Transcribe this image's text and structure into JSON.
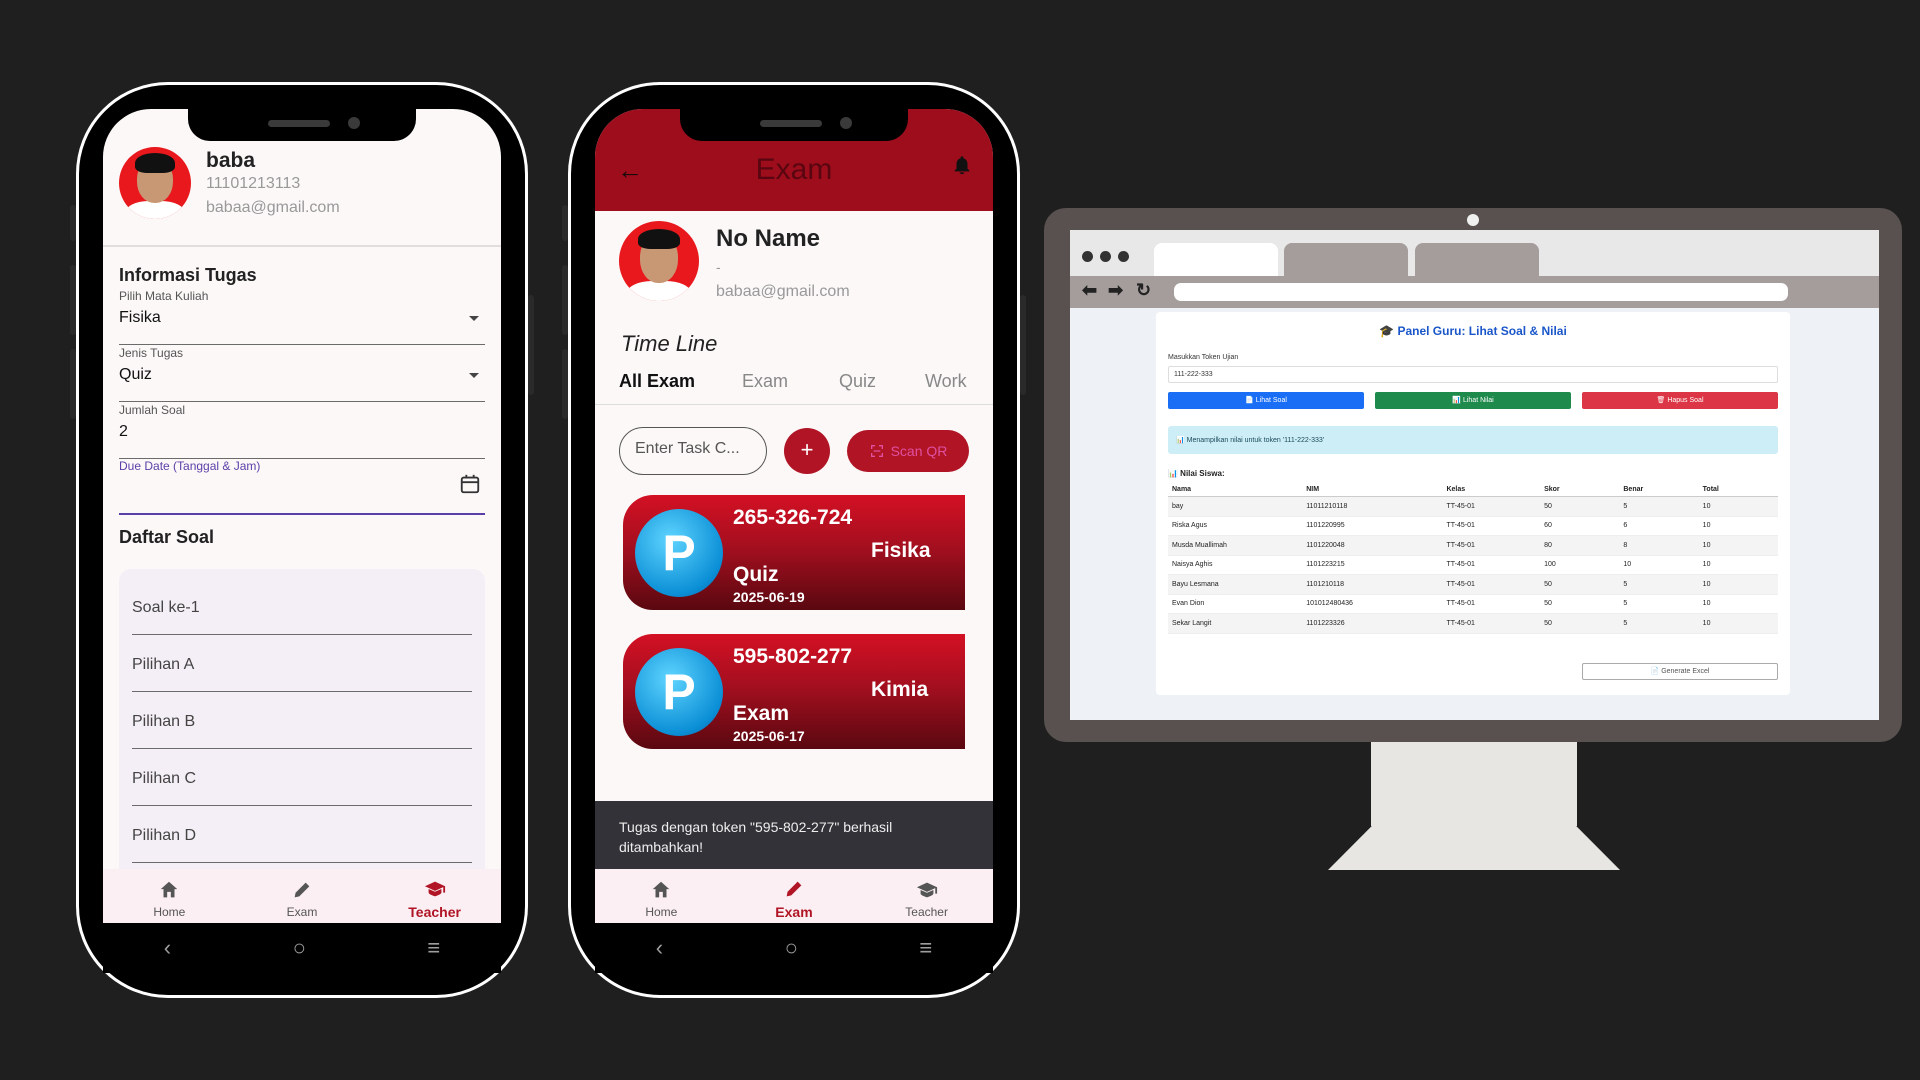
{
  "phone1": {
    "profile": {
      "name": "baba",
      "nim": "11101213113",
      "email": "babaa@gmail.com"
    },
    "form": {
      "section_title": "Informasi Tugas",
      "course": {
        "label": "Pilih Mata Kuliah",
        "value": "Fisika"
      },
      "task_type": {
        "label": "Jenis Tugas",
        "value": "Quiz"
      },
      "question_count": {
        "label": "Jumlah Soal",
        "value": "2"
      },
      "due_date": {
        "label": "Due Date (Tanggal & Jam)",
        "value": ""
      }
    },
    "questions": {
      "section_title": "Daftar Soal",
      "fields": [
        "Soal ke-1",
        "Pilihan A",
        "Pilihan B",
        "Pilihan C",
        "Pilihan D"
      ]
    },
    "bottom_nav": [
      {
        "label": "Home",
        "icon": "home-icon"
      },
      {
        "label": "Exam",
        "icon": "pencil-icon"
      },
      {
        "label": "Teacher",
        "icon": "school-icon"
      }
    ],
    "active_nav": "Teacher"
  },
  "phone2": {
    "appbar_title": "Exam",
    "profile": {
      "name": "No Name",
      "nim": "-",
      "email": "babaa@gmail.com"
    },
    "timeline_title": "Time Line",
    "tabs": [
      "All Exam",
      "Exam",
      "Quiz",
      "Work"
    ],
    "active_tab": "All Exam",
    "task_input_placeholder": "Enter Task C...",
    "plus_label": "+",
    "scan_label": "Scan QR",
    "exams": [
      {
        "badge": "P",
        "token": "265-326-724",
        "type": "Quiz",
        "date": "2025-06-19",
        "subject": "Fisika"
      },
      {
        "badge": "P",
        "token": "595-802-277",
        "type": "Exam",
        "date": "2025-06-17",
        "subject": "Kimia"
      }
    ],
    "snackbar": "Tugas dengan token \"595-802-277\" berhasil ditambahkan!",
    "bottom_nav": [
      {
        "label": "Home",
        "icon": "home-icon"
      },
      {
        "label": "Exam",
        "icon": "pencil-icon"
      },
      {
        "label": "Teacher",
        "icon": "school-icon"
      }
    ],
    "active_nav": "Exam"
  },
  "monitor": {
    "panel_title": "🎓 Panel Guru: Lihat Soal & Nilai",
    "token_label": "Masukkan Token Ujian",
    "token_value": "111-222-333",
    "buttons": {
      "view_questions": "📄 Lihat Soal",
      "view_grades": "📊 Lihat Nilai",
      "delete_questions": "🗑 Hapus Soal"
    },
    "info_message": "📊 Menampilkan nilai untuk token '111-222-333'",
    "grades_label": "📊 Nilai Siswa:",
    "table": {
      "headers": [
        "Nama",
        "NIM",
        "Kelas",
        "Skor",
        "Benar",
        "Total"
      ],
      "rows": [
        [
          "bay",
          "11011210118",
          "TT-45-01",
          "50",
          "5",
          "10"
        ],
        [
          "Riska Agus",
          "1101220995",
          "TT-45-01",
          "60",
          "6",
          "10"
        ],
        [
          "Musda Muallimah",
          "1101220048",
          "TT-45-01",
          "80",
          "8",
          "10"
        ],
        [
          "Naisya Aghis",
          "1101223215",
          "TT-45-01",
          "100",
          "10",
          "10"
        ],
        [
          "Bayu Lesmana",
          "1101210118",
          "TT-45-01",
          "50",
          "5",
          "10"
        ],
        [
          "Evan Dion",
          "101012480436",
          "TT-45-01",
          "50",
          "5",
          "10"
        ],
        [
          "Sekar Langit",
          "1101223326",
          "TT-45-01",
          "50",
          "5",
          "10"
        ]
      ]
    },
    "generate_label": "📄 Generate Excel"
  },
  "colors": {
    "accent_red": "#b01425",
    "appbar_red": "#9d0d1c",
    "blue_button": "#1a6ef5",
    "green_button": "#1e8a4c",
    "red_button": "#dc3545",
    "background": "#1f1f1f"
  }
}
